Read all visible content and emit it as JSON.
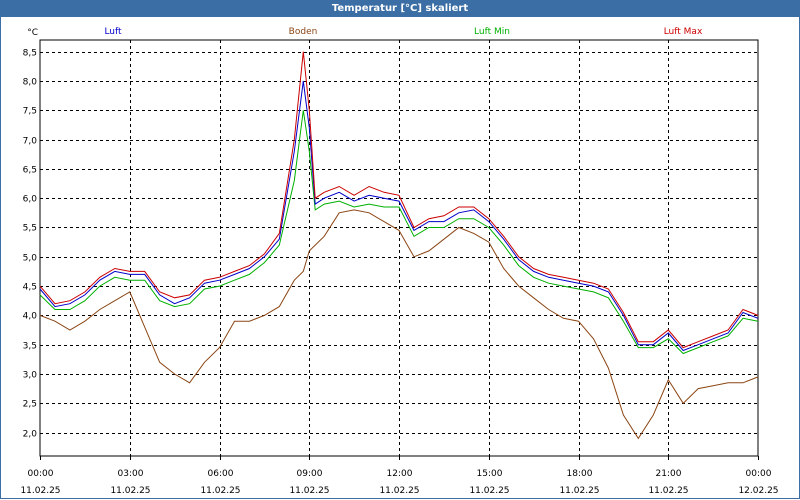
{
  "window": {
    "title": "Temperatur [°C] skaliert"
  },
  "chart_data": {
    "type": "line",
    "title": "Temperatur [°C] skaliert",
    "ylabel": "°C",
    "ylim": [
      1.6,
      8.7
    ],
    "yticks": [
      "2,0",
      "2,5",
      "3,0",
      "3,5",
      "4,0",
      "4,5",
      "5,0",
      "5,5",
      "6,0",
      "6,5",
      "7,0",
      "7,5",
      "8,0",
      "8,5"
    ],
    "xticks": [
      {
        "time": "00:00",
        "date": "11.02.25"
      },
      {
        "time": "03:00",
        "date": "11.02.25"
      },
      {
        "time": "06:00",
        "date": "11.02.25"
      },
      {
        "time": "09:00",
        "date": "11.02.25"
      },
      {
        "time": "12:00",
        "date": "11.02.25"
      },
      {
        "time": "15:00",
        "date": "11.02.25"
      },
      {
        "time": "18:00",
        "date": "11.02.25"
      },
      {
        "time": "21:00",
        "date": "11.02.25"
      },
      {
        "time": "00:00",
        "date": "12.02.25"
      }
    ],
    "grid": true,
    "legend_position": "top",
    "series": [
      {
        "name": "Luft",
        "color": "#0000cc",
        "x": [
          0,
          0.5,
          1,
          1.5,
          2,
          2.5,
          3,
          3.5,
          4,
          4.5,
          5,
          5.5,
          6,
          6.5,
          7,
          7.5,
          8,
          8.5,
          8.8,
          9,
          9.2,
          9.5,
          10,
          10.5,
          11,
          11.5,
          12,
          12.5,
          13,
          13.5,
          14,
          14.5,
          15,
          15.5,
          16,
          16.5,
          17,
          17.5,
          18,
          18.5,
          19,
          19.5,
          20,
          20.5,
          21,
          21.5,
          22,
          22.5,
          23,
          23.5,
          24
        ],
        "y": [
          4.45,
          4.15,
          4.2,
          4.35,
          4.6,
          4.75,
          4.7,
          4.7,
          4.35,
          4.2,
          4.3,
          4.55,
          4.6,
          4.7,
          4.8,
          5.0,
          5.3,
          6.8,
          8.0,
          7.2,
          5.9,
          6.0,
          6.1,
          5.95,
          6.05,
          6.0,
          5.95,
          5.45,
          5.6,
          5.6,
          5.75,
          5.8,
          5.6,
          5.3,
          4.95,
          4.75,
          4.65,
          4.6,
          4.55,
          4.5,
          4.4,
          4.0,
          3.5,
          3.5,
          3.7,
          3.4,
          3.5,
          3.6,
          3.7,
          4.05,
          3.95
        ]
      },
      {
        "name": "Boden",
        "color": "#8b4513",
        "x": [
          0,
          0.5,
          1,
          1.5,
          2,
          2.5,
          3,
          3.5,
          4,
          4.5,
          5,
          5.5,
          6,
          6.5,
          7,
          7.5,
          8,
          8.5,
          8.8,
          9,
          9.2,
          9.5,
          10,
          10.5,
          11,
          11.5,
          12,
          12.5,
          13,
          13.5,
          14,
          14.5,
          15,
          15.5,
          16,
          16.5,
          17,
          17.5,
          18,
          18.5,
          19,
          19.5,
          20,
          20.5,
          21,
          21.5,
          22,
          22.5,
          23,
          23.5,
          24
        ],
        "y": [
          4.0,
          3.9,
          3.75,
          3.9,
          4.1,
          4.25,
          4.4,
          3.8,
          3.2,
          3.0,
          2.85,
          3.2,
          3.45,
          3.9,
          3.9,
          4.0,
          4.15,
          4.6,
          4.75,
          5.1,
          5.2,
          5.35,
          5.75,
          5.8,
          5.75,
          5.6,
          5.45,
          5.0,
          5.1,
          5.3,
          5.5,
          5.4,
          5.25,
          4.8,
          4.5,
          4.3,
          4.1,
          3.95,
          3.9,
          3.6,
          3.1,
          2.3,
          1.9,
          2.3,
          2.9,
          2.5,
          2.75,
          2.8,
          2.85,
          2.85,
          2.95
        ]
      },
      {
        "name": "Luft Min",
        "color": "#00b000",
        "x": [
          0,
          0.5,
          1,
          1.5,
          2,
          2.5,
          3,
          3.5,
          4,
          4.5,
          5,
          5.5,
          6,
          6.5,
          7,
          7.5,
          8,
          8.5,
          8.8,
          9,
          9.2,
          9.5,
          10,
          10.5,
          11,
          11.5,
          12,
          12.5,
          13,
          13.5,
          14,
          14.5,
          15,
          15.5,
          16,
          16.5,
          17,
          17.5,
          18,
          18.5,
          19,
          19.5,
          20,
          20.5,
          21,
          21.5,
          22,
          22.5,
          23,
          23.5,
          24
        ],
        "y": [
          4.35,
          4.1,
          4.1,
          4.25,
          4.5,
          4.65,
          4.6,
          4.6,
          4.25,
          4.15,
          4.2,
          4.45,
          4.5,
          4.6,
          4.7,
          4.9,
          5.2,
          6.3,
          7.5,
          6.8,
          5.8,
          5.9,
          5.95,
          5.85,
          5.9,
          5.85,
          5.85,
          5.35,
          5.5,
          5.5,
          5.65,
          5.65,
          5.5,
          5.2,
          4.85,
          4.65,
          4.55,
          4.5,
          4.45,
          4.4,
          4.3,
          3.9,
          3.45,
          3.45,
          3.6,
          3.35,
          3.45,
          3.55,
          3.65,
          3.95,
          3.9
        ]
      },
      {
        "name": "Luft Max",
        "color": "#cc0000",
        "x": [
          0,
          0.5,
          1,
          1.5,
          2,
          2.5,
          3,
          3.5,
          4,
          4.5,
          5,
          5.5,
          6,
          6.5,
          7,
          7.5,
          8,
          8.5,
          8.8,
          9,
          9.2,
          9.5,
          10,
          10.5,
          11,
          11.5,
          12,
          12.5,
          13,
          13.5,
          14,
          14.5,
          15,
          15.5,
          16,
          16.5,
          17,
          17.5,
          18,
          18.5,
          19,
          19.5,
          20,
          20.5,
          21,
          21.5,
          22,
          22.5,
          23,
          23.5,
          24
        ],
        "y": [
          4.5,
          4.2,
          4.25,
          4.4,
          4.65,
          4.8,
          4.75,
          4.75,
          4.4,
          4.3,
          4.35,
          4.6,
          4.65,
          4.75,
          4.85,
          5.05,
          5.4,
          7.0,
          8.5,
          7.5,
          6.0,
          6.1,
          6.2,
          6.05,
          6.2,
          6.1,
          6.05,
          5.5,
          5.65,
          5.7,
          5.85,
          5.85,
          5.65,
          5.35,
          5.0,
          4.8,
          4.7,
          4.65,
          4.6,
          4.55,
          4.45,
          4.05,
          3.55,
          3.55,
          3.75,
          3.45,
          3.55,
          3.65,
          3.75,
          4.1,
          4.0
        ]
      }
    ]
  }
}
